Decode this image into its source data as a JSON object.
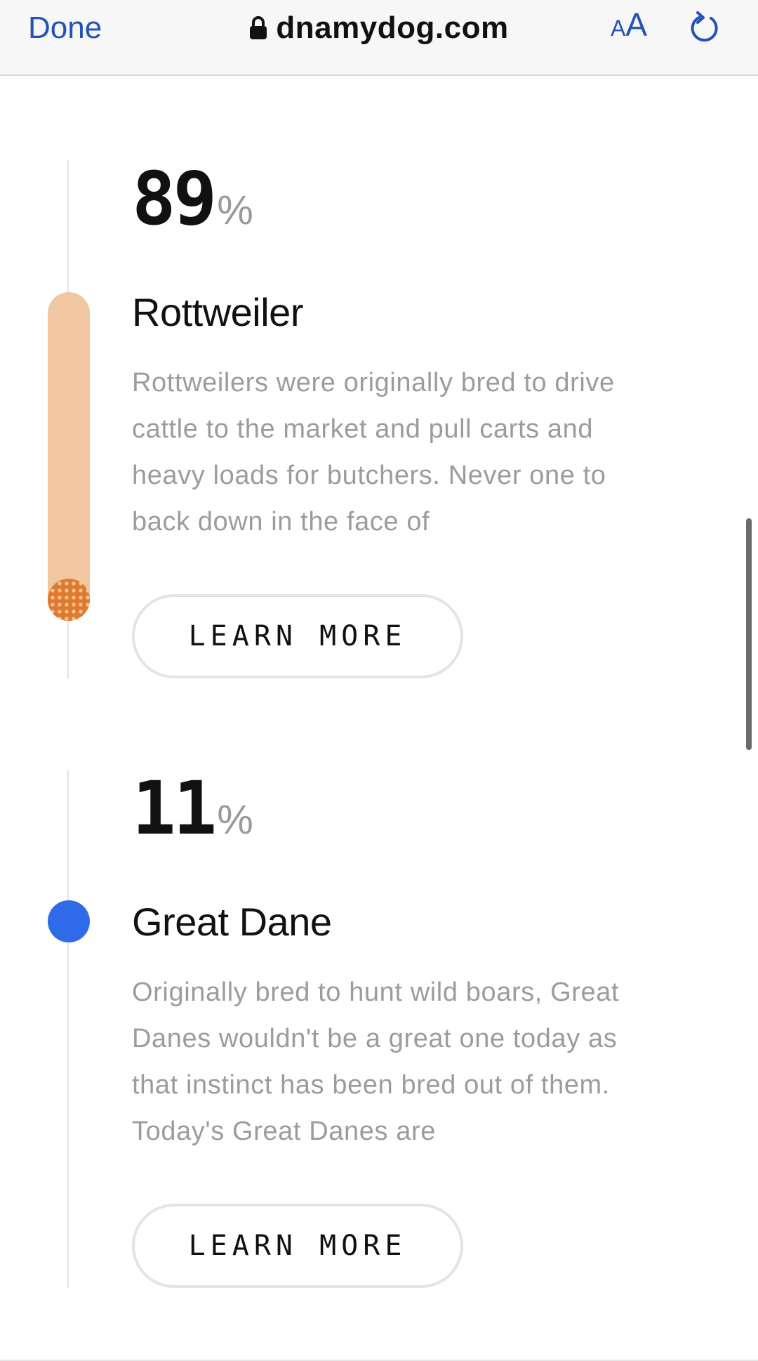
{
  "browser": {
    "done_label": "Done",
    "url": "dnamydog.com",
    "text_size_small": "A",
    "text_size_large": "A",
    "icons": [
      "lock-icon",
      "reload-icon"
    ],
    "accent_color": "#2353b8"
  },
  "breeds": [
    {
      "percent": "89",
      "percent_sign": "%",
      "name": "Rottweiler",
      "description": "Rottweilers were originally bred to drive cattle to the market and pull carts and heavy loads for butchers. Never one to back down in the face of",
      "button_label": "LEARN MORE",
      "indicator_color": "#e07a2f",
      "bar_color": "#f0c7a0"
    },
    {
      "percent": "11",
      "percent_sign": "%",
      "name": "Great Dane",
      "description": "Originally bred to hunt wild boars, Great Danes wouldn't be a great one today as that instinct has been bred out of them. Today's Great Danes are",
      "button_label": "LEARN MORE",
      "indicator_color": "#2f6be8"
    }
  ]
}
